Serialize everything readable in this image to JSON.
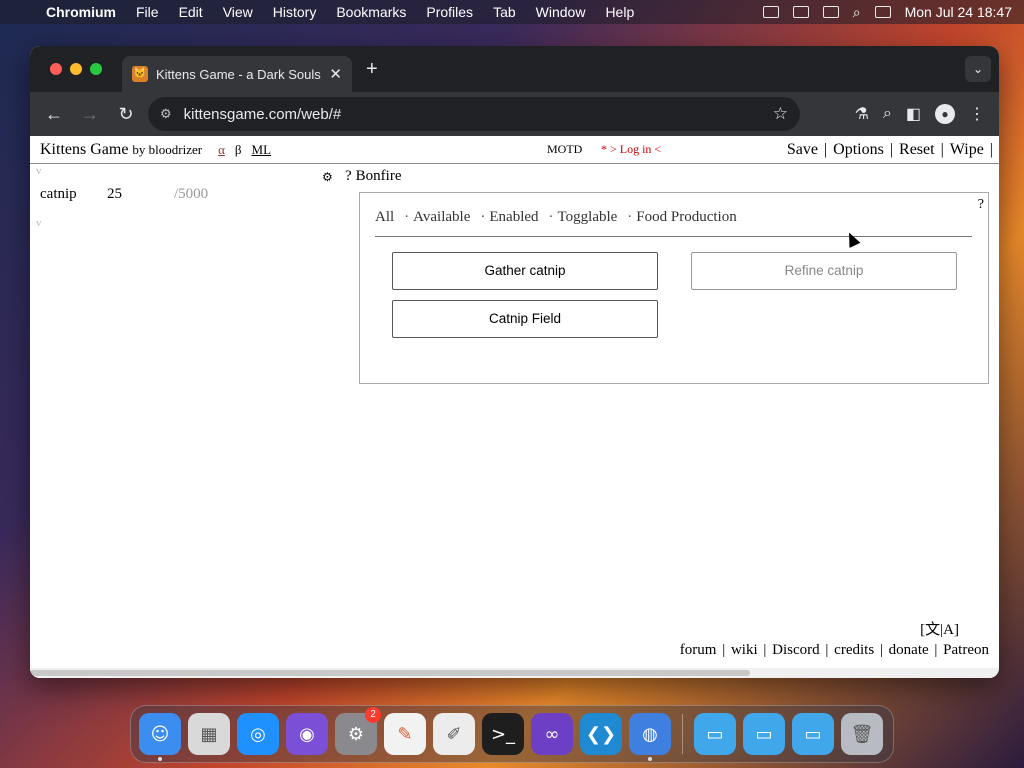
{
  "menubar": {
    "app_name": "Chromium",
    "menus": [
      "File",
      "Edit",
      "View",
      "History",
      "Bookmarks",
      "Profiles",
      "Tab",
      "Window",
      "Help"
    ],
    "datetime": "Mon Jul 24  18:47"
  },
  "browser": {
    "tab_title": "Kittens Game - a Dark Souls",
    "url": "kittensgame.com/web/#"
  },
  "game": {
    "title": "Kittens Game",
    "by": "by bloodrizer",
    "alpha": "α",
    "beta": "β",
    "ml": "ML",
    "motd": "MOTD",
    "login": "* > Log in <",
    "top_links": [
      "Save",
      "Options",
      "Reset",
      "Wipe"
    ],
    "caret1": "v",
    "caret2": "v",
    "resource": {
      "name": "catnip",
      "amount": "25",
      "max": "/5000"
    },
    "section_q": "?",
    "section_title": "Bonfire",
    "panel_q": "?",
    "filters": [
      "All",
      "Available",
      "Enabled",
      "Togglable",
      "Food Production"
    ],
    "buttons": {
      "gather": "Gather catnip",
      "refine": "Refine catnip",
      "field": "Catnip Field"
    },
    "lang": "[文|A]",
    "footer_links": [
      "forum",
      "wiki",
      "Discord",
      "credits",
      "donate",
      "Patreon"
    ]
  },
  "dock": {
    "apps": [
      {
        "icon": "finder-icon",
        "color": "#3b8df0"
      },
      {
        "icon": "launchpad-icon",
        "color": "#d9d9d9"
      },
      {
        "icon": "safari-icon",
        "color": "#1e90ff"
      },
      {
        "icon": "podcasts-icon",
        "color": "#7b4fd6"
      },
      {
        "icon": "system-settings-icon",
        "color": "#8a8a8e",
        "badge": "2"
      },
      {
        "icon": "freeform-icon",
        "color": "#f2f2f2"
      },
      {
        "icon": "textedit-icon",
        "color": "#ececec"
      },
      {
        "icon": "terminal-icon",
        "color": "#1e1e1e"
      },
      {
        "icon": "visual-studio-icon",
        "color": "#6c3fc4"
      },
      {
        "icon": "vscode-icon",
        "color": "#1f8ad2"
      },
      {
        "icon": "chromium-icon",
        "color": "#3f7fe0"
      }
    ],
    "folders": [
      "folder-icon",
      "folder-icon",
      "folder-icon"
    ],
    "trash": "trash-icon"
  }
}
